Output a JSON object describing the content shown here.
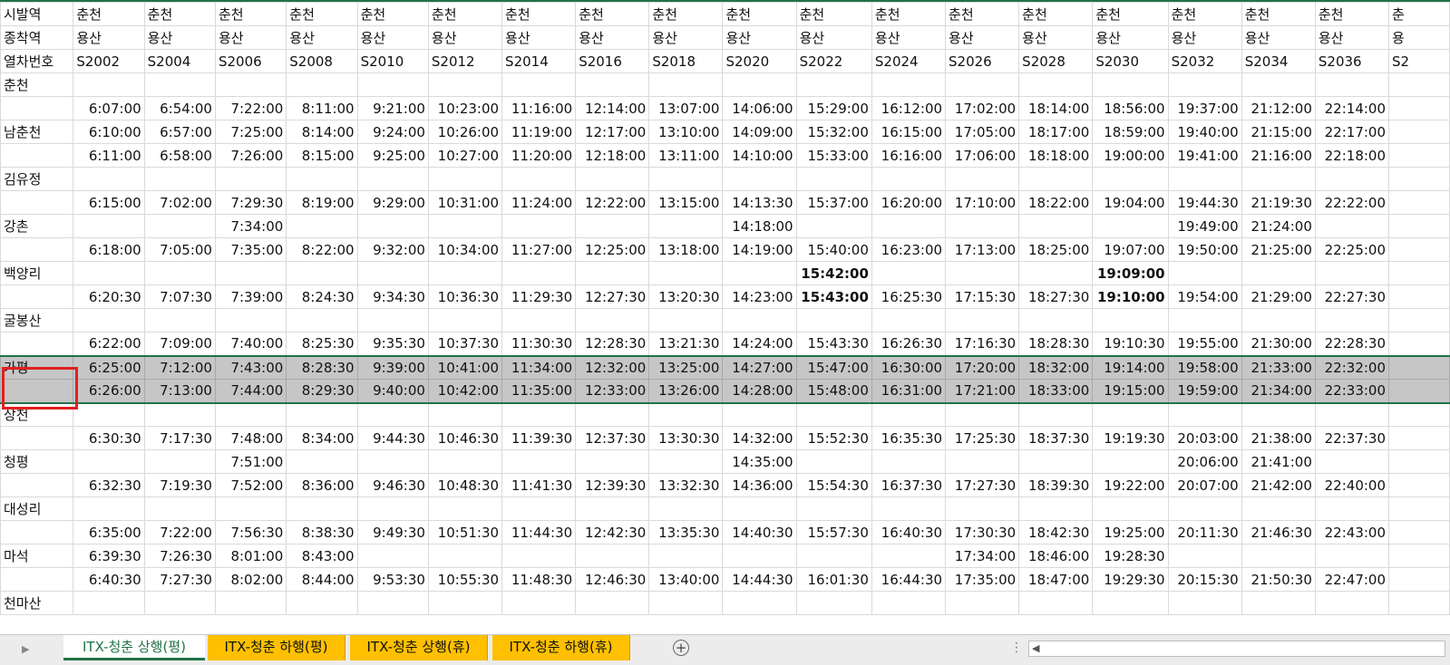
{
  "header_rows": [
    {
      "label": "시발역",
      "values": [
        "춘천",
        "춘천",
        "춘천",
        "춘천",
        "춘천",
        "춘천",
        "춘천",
        "춘천",
        "춘천",
        "춘천",
        "춘천",
        "춘천",
        "춘천",
        "춘천",
        "춘천",
        "춘천",
        "춘천",
        "춘천",
        "춘"
      ]
    },
    {
      "label": "종착역",
      "values": [
        "용산",
        "용산",
        "용산",
        "용산",
        "용산",
        "용산",
        "용산",
        "용산",
        "용산",
        "용산",
        "용산",
        "용산",
        "용산",
        "용산",
        "용산",
        "용산",
        "용산",
        "용산",
        "용"
      ]
    },
    {
      "label": "열차번호",
      "values": [
        "S2002",
        "S2004",
        "S2006",
        "S2008",
        "S2010",
        "S2012",
        "S2014",
        "S2016",
        "S2018",
        "S2020",
        "S2022",
        "S2024",
        "S2026",
        "S2028",
        "S2030",
        "S2032",
        "S2034",
        "S2036",
        "S2"
      ]
    }
  ],
  "rows": [
    {
      "label": "춘천",
      "values": [
        "",
        "",
        "",
        "",
        "",
        "",
        "",
        "",
        "",
        "",
        "",
        "",
        "",
        "",
        "",
        "",
        "",
        "",
        ""
      ]
    },
    {
      "label": "",
      "values": [
        "6:07:00",
        "6:54:00",
        "7:22:00",
        "8:11:00",
        "9:21:00",
        "10:23:00",
        "11:16:00",
        "12:14:00",
        "13:07:00",
        "14:06:00",
        "15:29:00",
        "16:12:00",
        "17:02:00",
        "18:14:00",
        "18:56:00",
        "19:37:00",
        "21:12:00",
        "22:14:00",
        ""
      ]
    },
    {
      "label": "남춘천",
      "values": [
        "6:10:00",
        "6:57:00",
        "7:25:00",
        "8:14:00",
        "9:24:00",
        "10:26:00",
        "11:19:00",
        "12:17:00",
        "13:10:00",
        "14:09:00",
        "15:32:00",
        "16:15:00",
        "17:05:00",
        "18:17:00",
        "18:59:00",
        "19:40:00",
        "21:15:00",
        "22:17:00",
        ""
      ]
    },
    {
      "label": "",
      "values": [
        "6:11:00",
        "6:58:00",
        "7:26:00",
        "8:15:00",
        "9:25:00",
        "10:27:00",
        "11:20:00",
        "12:18:00",
        "13:11:00",
        "14:10:00",
        "15:33:00",
        "16:16:00",
        "17:06:00",
        "18:18:00",
        "19:00:00",
        "19:41:00",
        "21:16:00",
        "22:18:00",
        ""
      ]
    },
    {
      "label": "김유정",
      "values": [
        "",
        "",
        "",
        "",
        "",
        "",
        "",
        "",
        "",
        "",
        "",
        "",
        "",
        "",
        "",
        "",
        "",
        "",
        ""
      ]
    },
    {
      "label": "",
      "values": [
        "6:15:00",
        "7:02:00",
        "7:29:30",
        "8:19:00",
        "9:29:00",
        "10:31:00",
        "11:24:00",
        "12:22:00",
        "13:15:00",
        "14:13:30",
        "15:37:00",
        "16:20:00",
        "17:10:00",
        "18:22:00",
        "19:04:00",
        "19:44:30",
        "21:19:30",
        "22:22:00",
        ""
      ]
    },
    {
      "label": "강촌",
      "values": [
        "",
        "",
        "7:34:00",
        "",
        "",
        "",
        "",
        "",
        "",
        "14:18:00",
        "",
        "",
        "",
        "",
        "",
        "19:49:00",
        "21:24:00",
        "",
        ""
      ]
    },
    {
      "label": "",
      "values": [
        "6:18:00",
        "7:05:00",
        "7:35:00",
        "8:22:00",
        "9:32:00",
        "10:34:00",
        "11:27:00",
        "12:25:00",
        "13:18:00",
        "14:19:00",
        "15:40:00",
        "16:23:00",
        "17:13:00",
        "18:25:00",
        "19:07:00",
        "19:50:00",
        "21:25:00",
        "22:25:00",
        ""
      ]
    },
    {
      "label": "백양리",
      "values": [
        "",
        "",
        "",
        "",
        "",
        "",
        "",
        "",
        "",
        "",
        "15:42:00",
        "",
        "",
        "",
        "19:09:00",
        "",
        "",
        "",
        ""
      ],
      "bold": [
        10,
        14
      ]
    },
    {
      "label": "",
      "values": [
        "6:20:30",
        "7:07:30",
        "7:39:00",
        "8:24:30",
        "9:34:30",
        "10:36:30",
        "11:29:30",
        "12:27:30",
        "13:20:30",
        "14:23:00",
        "15:43:00",
        "16:25:30",
        "17:15:30",
        "18:27:30",
        "19:10:00",
        "19:54:00",
        "21:29:00",
        "22:27:30",
        ""
      ],
      "bold": [
        10,
        14
      ]
    },
    {
      "label": "굴봉산",
      "values": [
        "",
        "",
        "",
        "",
        "",
        "",
        "",
        "",
        "",
        "",
        "",
        "",
        "",
        "",
        "",
        "",
        "",
        "",
        ""
      ]
    },
    {
      "label": "",
      "values": [
        "6:22:00",
        "7:09:00",
        "7:40:00",
        "8:25:30",
        "9:35:30",
        "10:37:30",
        "11:30:30",
        "12:28:30",
        "13:21:30",
        "14:24:00",
        "15:43:30",
        "16:26:30",
        "17:16:30",
        "18:28:30",
        "19:10:30",
        "19:55:00",
        "21:30:00",
        "22:28:30",
        ""
      ]
    },
    {
      "label": "가평",
      "values": [
        "6:25:00",
        "7:12:00",
        "7:43:00",
        "8:28:30",
        "9:39:00",
        "10:41:00",
        "11:34:00",
        "12:32:00",
        "13:25:00",
        "14:27:00",
        "15:47:00",
        "16:30:00",
        "17:20:00",
        "18:32:00",
        "19:14:00",
        "19:58:00",
        "21:33:00",
        "22:32:00",
        ""
      ],
      "selected": true
    },
    {
      "label": "",
      "values": [
        "6:26:00",
        "7:13:00",
        "7:44:00",
        "8:29:30",
        "9:40:00",
        "10:42:00",
        "11:35:00",
        "12:33:00",
        "13:26:00",
        "14:28:00",
        "15:48:00",
        "16:31:00",
        "17:21:00",
        "18:33:00",
        "19:15:00",
        "19:59:00",
        "21:34:00",
        "22:33:00",
        ""
      ],
      "selected": true
    },
    {
      "label": "상천",
      "values": [
        "",
        "",
        "",
        "",
        "",
        "",
        "",
        "",
        "",
        "",
        "",
        "",
        "",
        "",
        "",
        "",
        "",
        "",
        ""
      ]
    },
    {
      "label": "",
      "values": [
        "6:30:30",
        "7:17:30",
        "7:48:00",
        "8:34:00",
        "9:44:30",
        "10:46:30",
        "11:39:30",
        "12:37:30",
        "13:30:30",
        "14:32:00",
        "15:52:30",
        "16:35:30",
        "17:25:30",
        "18:37:30",
        "19:19:30",
        "20:03:00",
        "21:38:00",
        "22:37:30",
        ""
      ]
    },
    {
      "label": "청평",
      "values": [
        "",
        "",
        "7:51:00",
        "",
        "",
        "",
        "",
        "",
        "",
        "14:35:00",
        "",
        "",
        "",
        "",
        "",
        "20:06:00",
        "21:41:00",
        "",
        ""
      ]
    },
    {
      "label": "",
      "values": [
        "6:32:30",
        "7:19:30",
        "7:52:00",
        "8:36:00",
        "9:46:30",
        "10:48:30",
        "11:41:30",
        "12:39:30",
        "13:32:30",
        "14:36:00",
        "15:54:30",
        "16:37:30",
        "17:27:30",
        "18:39:30",
        "19:22:00",
        "20:07:00",
        "21:42:00",
        "22:40:00",
        ""
      ]
    },
    {
      "label": "대성리",
      "values": [
        "",
        "",
        "",
        "",
        "",
        "",
        "",
        "",
        "",
        "",
        "",
        "",
        "",
        "",
        "",
        "",
        "",
        "",
        ""
      ]
    },
    {
      "label": "",
      "values": [
        "6:35:00",
        "7:22:00",
        "7:56:30",
        "8:38:30",
        "9:49:30",
        "10:51:30",
        "11:44:30",
        "12:42:30",
        "13:35:30",
        "14:40:30",
        "15:57:30",
        "16:40:30",
        "17:30:30",
        "18:42:30",
        "19:25:00",
        "20:11:30",
        "21:46:30",
        "22:43:00",
        ""
      ]
    },
    {
      "label": "마석",
      "values": [
        "6:39:30",
        "7:26:30",
        "8:01:00",
        "8:43:00",
        "",
        "",
        "",
        "",
        "",
        "",
        "",
        "",
        "17:34:00",
        "18:46:00",
        "19:28:30",
        "",
        "",
        "",
        ""
      ]
    },
    {
      "label": "",
      "values": [
        "6:40:30",
        "7:27:30",
        "8:02:00",
        "8:44:00",
        "9:53:30",
        "10:55:30",
        "11:48:30",
        "12:46:30",
        "13:40:00",
        "14:44:30",
        "16:01:30",
        "16:44:30",
        "17:35:00",
        "18:47:00",
        "19:29:30",
        "20:15:30",
        "21:50:30",
        "22:47:00",
        ""
      ]
    },
    {
      "label": "천마산",
      "values": [
        "",
        "",
        "",
        "",
        "",
        "",
        "",
        "",
        "",
        "",
        "",
        "",
        "",
        "",
        "",
        "",
        "",
        "",
        ""
      ]
    }
  ],
  "sheet_tabs": [
    {
      "label": "ITX-청춘 상행(평)",
      "active": true
    },
    {
      "label": "ITX-청춘 하행(평)",
      "active": false
    },
    {
      "label": "ITX-청춘 상행(휴)",
      "active": false
    },
    {
      "label": "ITX-청춘 하행(휴)",
      "active": false
    }
  ],
  "icons": {
    "add_sheet": "plus-circle-icon",
    "prev": "triangle-left-icon",
    "more": "vertical-dots-icon"
  },
  "colors": {
    "accent": "#217346",
    "tab_yellow": "#ffc000",
    "selection": "#c6c6c6",
    "highlight_box": "#e02020"
  }
}
